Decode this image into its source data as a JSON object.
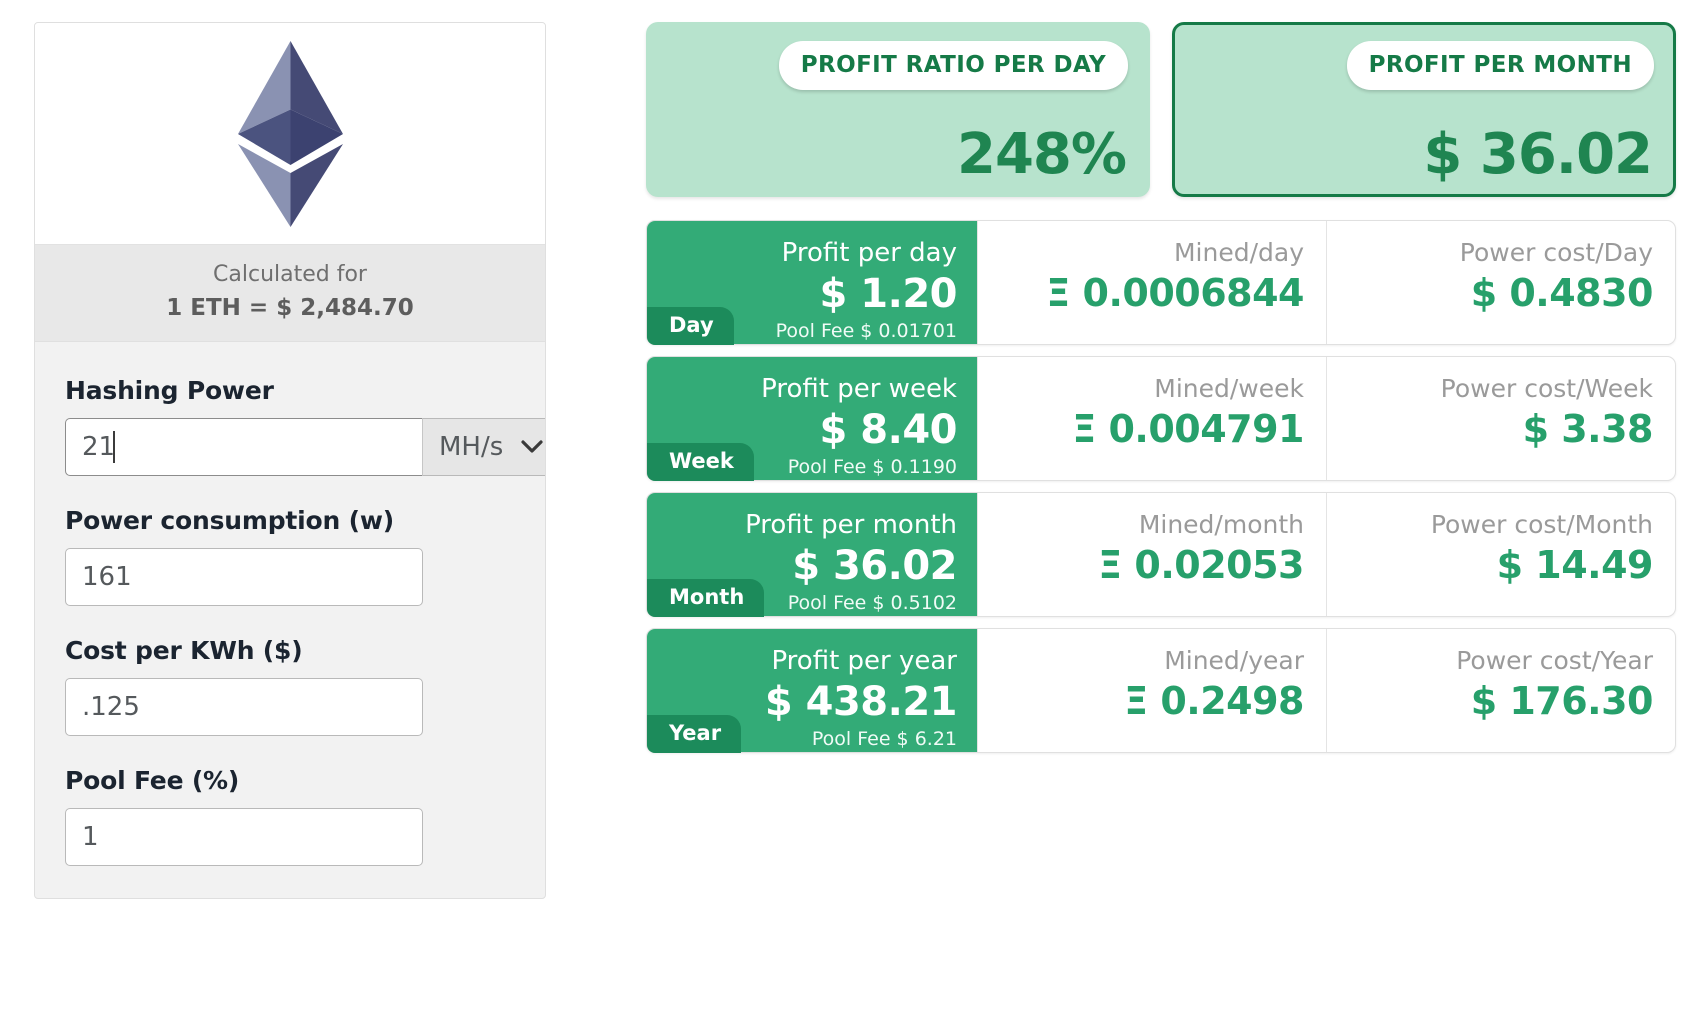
{
  "calculator": {
    "coin_icon": "ethereum-logo",
    "calculated_for_label": "Calculated for",
    "rate_text": "1 ETH = $ 2,484.70",
    "fields": [
      {
        "label": "Hashing Power",
        "value": "21",
        "unit": "MH/s",
        "unit_icon": "chevron-down-icon",
        "focused": true
      },
      {
        "label": "Power consumption (w)",
        "value": "161",
        "focused": false
      },
      {
        "label": "Cost per KWh ($)",
        "value": ".125",
        "focused": false
      },
      {
        "label": "Pool Fee (%)",
        "value": "1",
        "focused": false
      }
    ]
  },
  "summary": {
    "cards": [
      {
        "label": "PROFIT RATIO PER DAY",
        "value": "248%",
        "selected": false
      },
      {
        "label": "PROFIT PER MONTH",
        "value": "$ 36.02",
        "selected": true
      }
    ]
  },
  "results": {
    "rows": [
      {
        "badge": "Day",
        "profit_label": "Profit per day",
        "profit_value": "$ 1.20",
        "pool_fee": "Pool Fee $ 0.01701",
        "mined_label": "Mined/day",
        "mined_value": "Ξ 0.0006844",
        "power_label": "Power cost/Day",
        "power_value": "$ 0.4830"
      },
      {
        "badge": "Week",
        "profit_label": "Profit per week",
        "profit_value": "$ 8.40",
        "pool_fee": "Pool Fee $ 0.1190",
        "mined_label": "Mined/week",
        "mined_value": "Ξ 0.004791",
        "power_label": "Power cost/Week",
        "power_value": "$ 3.38"
      },
      {
        "badge": "Month",
        "profit_label": "Profit per month",
        "profit_value": "$ 36.02",
        "pool_fee": "Pool Fee $ 0.5102",
        "mined_label": "Mined/month",
        "mined_value": "Ξ 0.02053",
        "power_label": "Power cost/Month",
        "power_value": "$ 14.49"
      },
      {
        "badge": "Year",
        "profit_label": "Profit per year",
        "profit_value": "$ 438.21",
        "pool_fee": "Pool Fee $ 6.21",
        "mined_label": "Mined/year",
        "mined_value": "Ξ 0.2498",
        "power_label": "Power cost/Year",
        "power_value": "$ 176.30"
      }
    ]
  },
  "colors": {
    "accent_green": "#33ab77",
    "dark_green": "#157a47",
    "mint": "#b7e3cd",
    "badge_green": "#1c8b5b"
  }
}
